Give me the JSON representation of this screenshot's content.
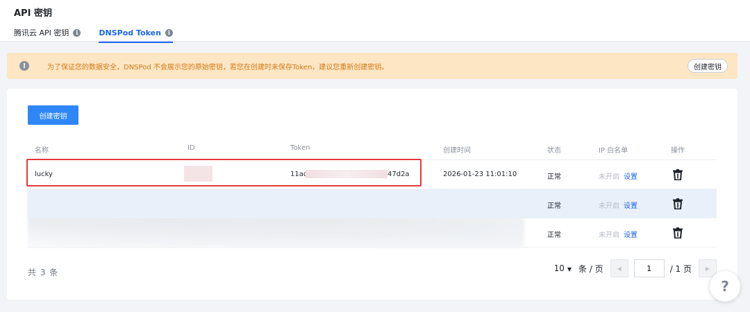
{
  "header": {
    "title": "API 密钥",
    "tabs": [
      {
        "label": "腾讯云 API 密钥",
        "active": false
      },
      {
        "label": "DNSPod Token",
        "active": true
      }
    ]
  },
  "notice": {
    "text": "为了保证您的数据安全，DNSPod 不会展示您的原始密钥，若您在创建时未保存Token，建议您重新创建密钥。",
    "button": "创建密钥"
  },
  "toolbar": {
    "create_button": "创建密钥"
  },
  "table": {
    "columns": [
      "名称",
      "ID",
      "Token",
      "创建时间",
      "状态",
      "IP 白名单",
      "操作"
    ],
    "rows": [
      {
        "name": "lucky",
        "token_prefix": "11ad",
        "token_suffix": "47d2a",
        "created": "2026-01-23 11:01:10",
        "status": "正常",
        "whitelist": "未开启",
        "setting": "设置"
      },
      {
        "status": "正常",
        "whitelist": "未开启",
        "setting": "设置"
      },
      {
        "status": "正常",
        "whitelist": "未开启",
        "setting": "设置"
      }
    ]
  },
  "footer": {
    "total": "共 3 条",
    "page_size": "10",
    "page_size_unit": "条 / 页",
    "current_page": "1",
    "page_total": "/ 1 页"
  },
  "help": {
    "label": "?"
  },
  "colors": {
    "primary": "#2f86f6",
    "warning_bg": "#fde6c4",
    "warning_text": "#d07a16",
    "highlight": "#e5393a"
  }
}
